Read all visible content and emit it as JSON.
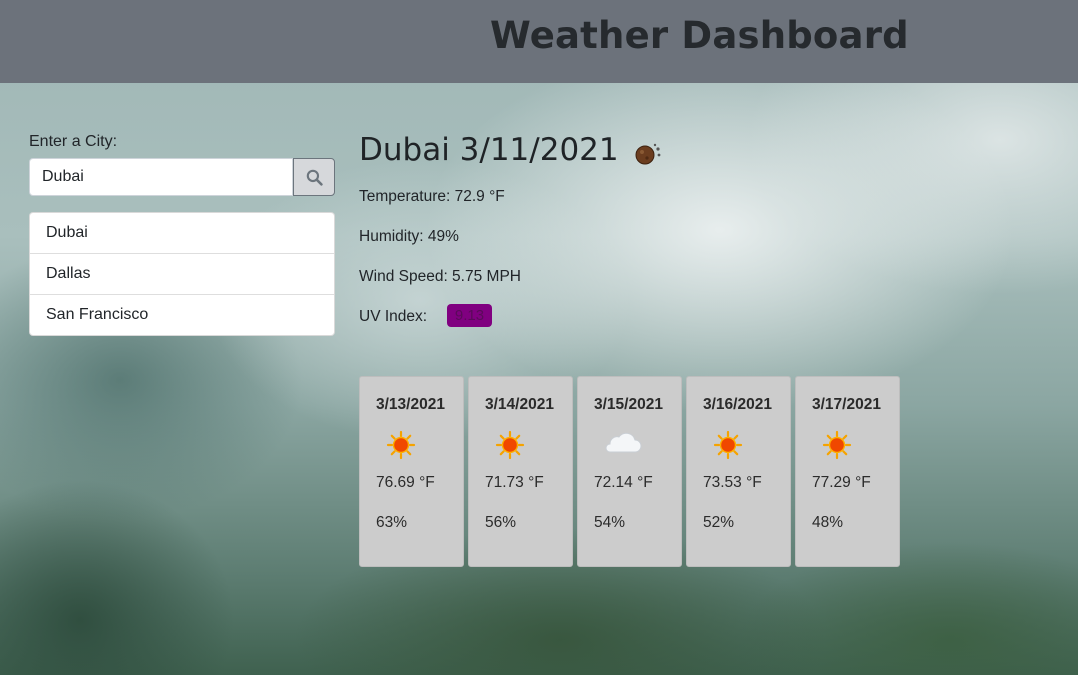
{
  "header": {
    "title": "Weather Dashboard"
  },
  "search": {
    "label": "Enter a City:",
    "value": "Dubai",
    "button_icon": "search-icon"
  },
  "history": [
    {
      "label": "Dubai"
    },
    {
      "label": "Dallas"
    },
    {
      "label": "San Francisco"
    }
  ],
  "current": {
    "title": "Dubai 3/11/2021",
    "icon": "meteor-icon",
    "temperature": "Temperature: 72.9 °F",
    "humidity": "Humidity: 49%",
    "wind": "Wind Speed: 5.75 MPH",
    "uv_label": "UV Index:",
    "uv_value": "9.13",
    "uv_color": "#800080"
  },
  "forecast": [
    {
      "date": "3/13/2021",
      "icon": "sun-icon",
      "temp": "76.69 °F",
      "humidity": "63%"
    },
    {
      "date": "3/14/2021",
      "icon": "sun-icon",
      "temp": "71.73 °F",
      "humidity": "56%"
    },
    {
      "date": "3/15/2021",
      "icon": "cloud-icon",
      "temp": "72.14 °F",
      "humidity": "54%"
    },
    {
      "date": "3/16/2021",
      "icon": "sun-icon",
      "temp": "73.53 °F",
      "humidity": "52%"
    },
    {
      "date": "3/17/2021",
      "icon": "sun-icon",
      "temp": "77.29 °F",
      "humidity": "48%"
    }
  ]
}
